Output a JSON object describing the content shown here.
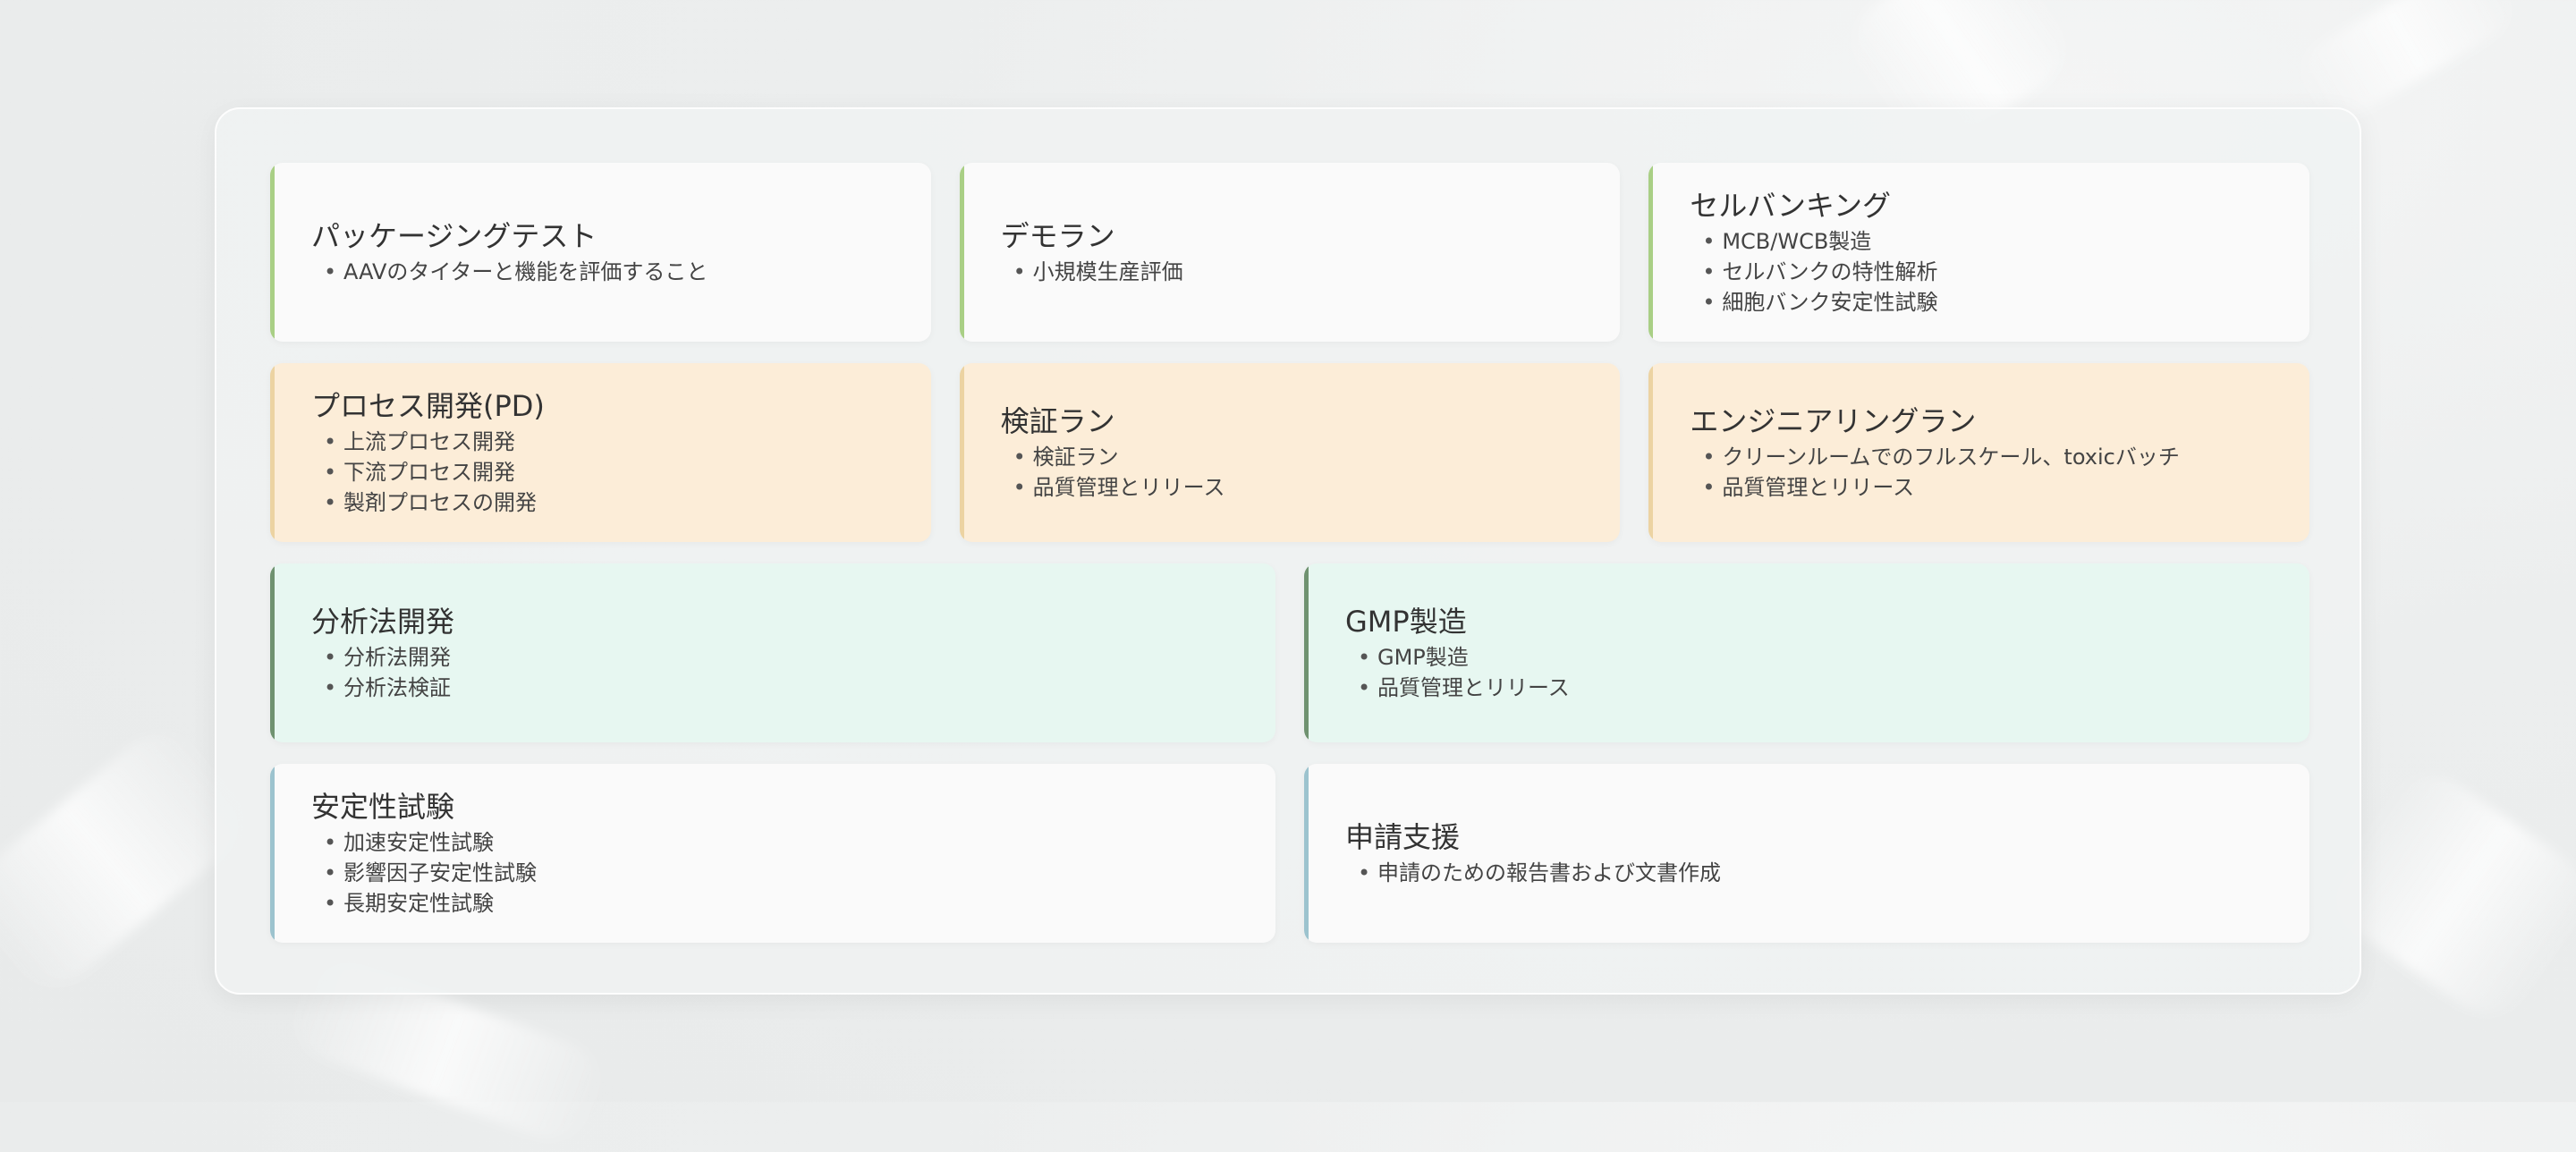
{
  "colors": {
    "accent_green": "#a9cf85",
    "accent_peach": "#ecd3a2",
    "accent_darkgreen": "#6f9270",
    "accent_blue": "#9cc3ce",
    "card_white": "#fafafa",
    "card_peach": "#fcedd8",
    "card_mint": "#e7f7f1"
  },
  "rows": [
    {
      "cards": [
        {
          "title": "パッケージングテスト",
          "items": [
            "AAVのタイターと機能を評価すること"
          ]
        },
        {
          "title": "デモラン",
          "items": [
            "小規模生産評価"
          ]
        },
        {
          "title": "セルバンキング",
          "items": [
            "MCB/WCB製造",
            "セルバンクの特性解析",
            "細胞バンク安定性試験"
          ]
        }
      ]
    },
    {
      "cards": [
        {
          "title": "プロセス開発(PD)",
          "items": [
            "上流プロセス開発",
            "下流プロセス開発",
            "製剤プロセスの開発"
          ]
        },
        {
          "title": "検証ラン",
          "items": [
            "検証ラン",
            "品質管理とリリース"
          ]
        },
        {
          "title": "エンジニアリングラン",
          "items": [
            "クリーンルームでのフルスケール、toxicバッチ",
            "品質管理とリリース"
          ]
        }
      ]
    },
    {
      "cards": [
        {
          "title": "分析法開発",
          "items": [
            "分析法開発",
            "分析法検証"
          ]
        },
        {
          "title": "GMP製造",
          "items": [
            "GMP製造",
            "品質管理とリリース"
          ]
        }
      ]
    },
    {
      "cards": [
        {
          "title": "安定性試験",
          "items": [
            "加速安定性試験",
            "影響因子安定性試験",
            "長期安定性試験"
          ]
        },
        {
          "title": "申請支援",
          "items": [
            "申請のための報告書および文書作成"
          ]
        }
      ]
    }
  ]
}
